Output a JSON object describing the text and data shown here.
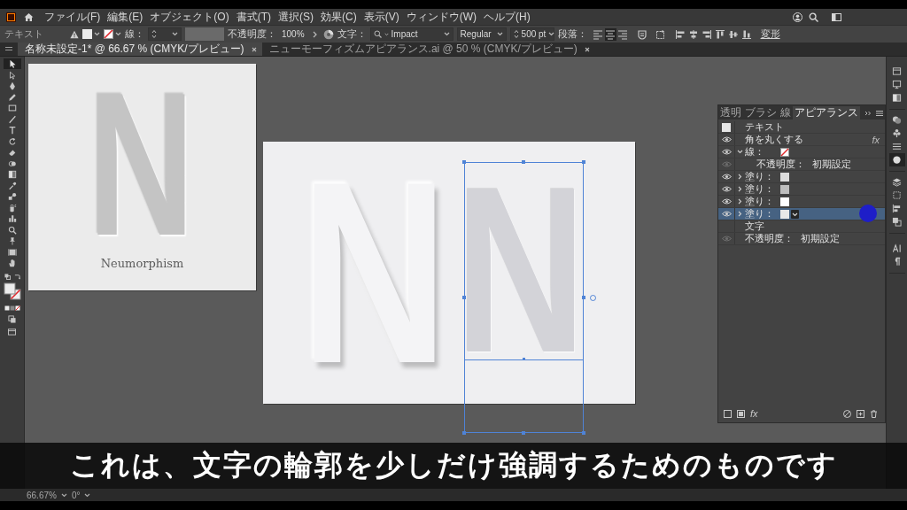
{
  "menubar": {
    "items": [
      "ファイル(F)",
      "編集(E)",
      "オブジェクト(O)",
      "書式(T)",
      "選択(S)",
      "効果(C)",
      "表示(V)",
      "ウィンドウ(W)",
      "ヘルプ(H)"
    ]
  },
  "control_bar": {
    "object_type": "テキスト",
    "stroke_label": "線：",
    "opacity_label": "不透明度：",
    "opacity_value": "100%",
    "character_label": "文字：",
    "font_family": "Impact",
    "font_style": "Regular",
    "font_size": "500 pt",
    "paragraph_label": "段落：",
    "paragraph_align": [
      {
        "selected": false
      },
      {
        "selected": true
      },
      {
        "selected": false
      }
    ],
    "transform_link": "変形"
  },
  "document_tabs": [
    {
      "title": "名称未設定-1* @ 66.67 % (CMYK/プレビュー)",
      "selected": true
    },
    {
      "title": "ニューモーフィズムアピアランス.ai @ 50 % (CMYK/プレビュー)",
      "selected": false
    }
  ],
  "toolbar": {
    "tools": [
      {
        "selected": true
      },
      {
        "selected": false
      },
      {
        "selected": false
      },
      {
        "selected": false
      },
      {
        "selected": false
      },
      {
        "selected": false
      },
      {
        "selected": false
      },
      {
        "selected": false
      },
      {
        "selected": false
      },
      {
        "selected": false
      },
      {
        "selected": false
      },
      {
        "selected": false
      },
      {
        "selected": false
      },
      {
        "selected": false
      },
      {
        "selected": false
      },
      {
        "selected": false
      },
      {
        "selected": false
      },
      {
        "selected": false
      },
      {
        "selected": false
      }
    ]
  },
  "artboards": [
    {
      "letters": [
        {
          "text": "N",
          "kind": "embossed",
          "selected": false
        }
      ],
      "caption": "Neumorphism"
    },
    {
      "letters": [
        {
          "text": "N",
          "kind": "raised",
          "selected": false
        },
        {
          "text": "N",
          "kind": "inset",
          "selected": true
        }
      ]
    }
  ],
  "appearance_panel": {
    "tabs": [
      {
        "label": "透明",
        "selected": false
      },
      {
        "label": "ブラシ",
        "selected": false
      },
      {
        "label": "線",
        "selected": false
      },
      {
        "label": "アピアランス",
        "selected": true
      }
    ],
    "rows": [
      {
        "kind": "header",
        "label": "テキスト",
        "selected": false
      },
      {
        "kind": "effect",
        "label": "角を丸くする",
        "badge": "fx",
        "visible": true,
        "selected": false
      },
      {
        "kind": "stroke",
        "label": "線：",
        "visible": true,
        "expanded": true,
        "selected": false,
        "children": [
          {
            "kind": "attribute",
            "label": "不透明度：",
            "value": "初期設定",
            "visible": false,
            "selected": false
          }
        ]
      },
      {
        "kind": "fill",
        "label": "塗り：",
        "color": "#dcdcdc",
        "visible": true,
        "expanded": false,
        "selected": false
      },
      {
        "kind": "fill",
        "label": "塗り：",
        "color": "#bdbdbd",
        "visible": true,
        "expanded": false,
        "selected": false
      },
      {
        "kind": "fill",
        "label": "塗り：",
        "color": "#ffffff",
        "visible": true,
        "expanded": false,
        "selected": false
      },
      {
        "kind": "fill",
        "label": "塗り：",
        "color": "#e8e8e8",
        "visible": true,
        "expanded": false,
        "selected": true
      },
      {
        "kind": "section",
        "label": "文字",
        "selected": false
      },
      {
        "kind": "attribute",
        "label": "不透明度：",
        "value": "初期設定",
        "visible": false,
        "selected": false
      }
    ],
    "footer_fx": "fx"
  },
  "dock": {
    "groups": [
      {
        "icons": [
          {
            "selected": false
          },
          {
            "selected": false
          },
          {
            "selected": false
          }
        ]
      },
      {
        "icons": [
          {
            "selected": false
          },
          {
            "selected": false
          },
          {
            "selected": false
          },
          {
            "selected": true
          }
        ]
      },
      {
        "icons": [
          {
            "selected": false
          },
          {
            "selected": false
          },
          {
            "selected": false
          },
          {
            "selected": false
          }
        ]
      },
      {
        "icons": [
          {
            "selected": false
          },
          {
            "selected": false
          }
        ]
      }
    ]
  },
  "status_bar": {
    "zoom": "66.67%",
    "rotation": "0°"
  },
  "subtitle": "これは、文字の輪郭を少しだけ強調するためのものです"
}
